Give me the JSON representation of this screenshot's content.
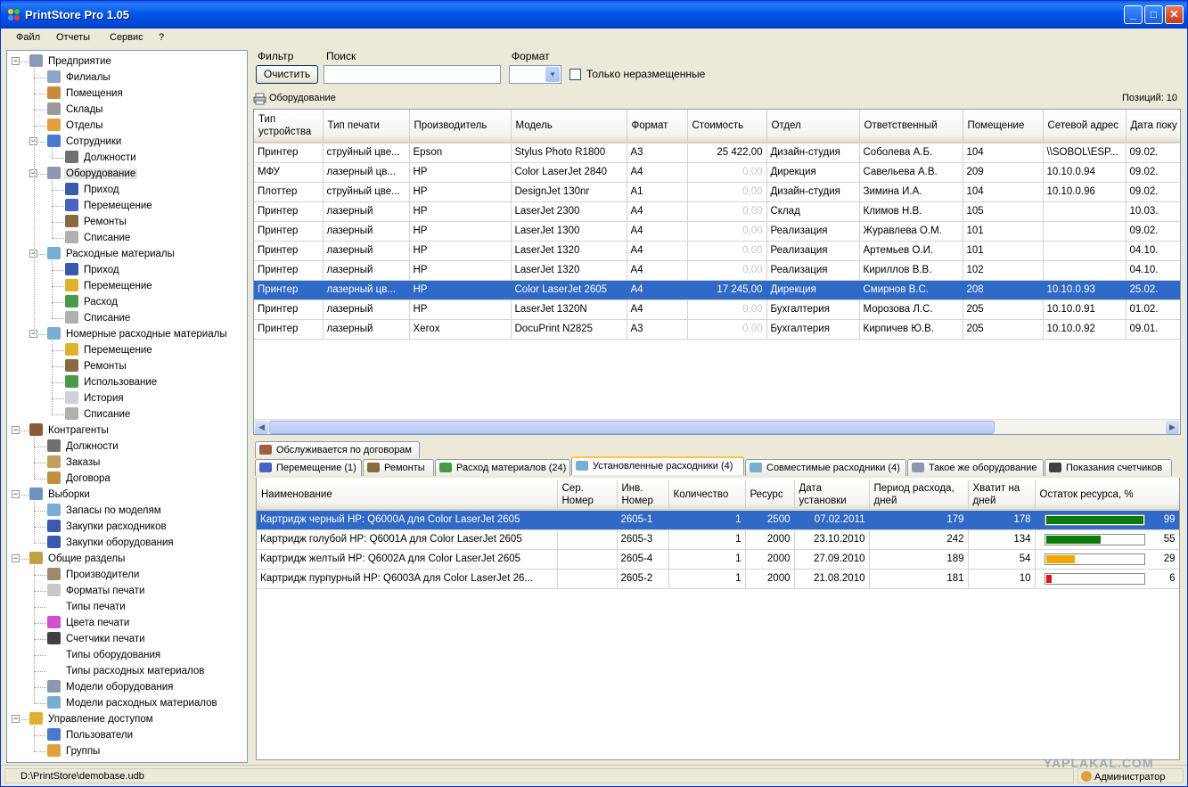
{
  "app": {
    "title": "PrintStore Pro 1.05"
  },
  "menu": [
    "Файл",
    "Отчеты",
    "Сервис",
    "?"
  ],
  "tree": [
    {
      "label": "Предприятие",
      "level": 0,
      "toggle": "−",
      "icon": "building-icon",
      "color": "#8a9ab8"
    },
    {
      "label": "Филиалы",
      "level": 1,
      "icon": "office-icon",
      "color": "#8fa4c8"
    },
    {
      "label": "Помещения",
      "level": 1,
      "icon": "door-icon",
      "color": "#c98a3a"
    },
    {
      "label": "Склады",
      "level": 1,
      "icon": "warehouse-icon",
      "color": "#9a9a9a"
    },
    {
      "label": "Отделы",
      "level": 1,
      "icon": "people-icon",
      "color": "#e0a040"
    },
    {
      "label": "Сотрудники",
      "level": 1,
      "toggle": "−",
      "icon": "employee-icon",
      "color": "#4a7ad0"
    },
    {
      "label": "Должности",
      "level": 2,
      "icon": "position-icon",
      "color": "#707070"
    },
    {
      "label": "Оборудование",
      "level": 1,
      "toggle": "−",
      "icon": "printer-icon",
      "color": "#8c98b0",
      "selected": true
    },
    {
      "label": "Приход",
      "level": 2,
      "icon": "truck-icon",
      "color": "#3a5ab0"
    },
    {
      "label": "Перемещение",
      "level": 2,
      "icon": "cart-icon",
      "color": "#4a62c0"
    },
    {
      "label": "Ремонты",
      "level": 2,
      "icon": "hammer-icon",
      "color": "#8a6a40"
    },
    {
      "label": "Списание",
      "level": 2,
      "icon": "writeoff-icon",
      "color": "#b0b0b0"
    },
    {
      "label": "Расходные материалы",
      "level": 1,
      "toggle": "−",
      "icon": "cartridge-icon",
      "color": "#7aaed0"
    },
    {
      "label": "Приход",
      "level": 2,
      "icon": "truck-icon",
      "color": "#3a5ab0"
    },
    {
      "label": "Перемещение",
      "level": 2,
      "icon": "move-icon",
      "color": "#e0b030"
    },
    {
      "label": "Расход",
      "level": 2,
      "icon": "consumption-icon",
      "color": "#4a9a4a"
    },
    {
      "label": "Списание",
      "level": 2,
      "icon": "writeoff-icon",
      "color": "#b0b0b0"
    },
    {
      "label": "Номерные расходные материалы",
      "level": 1,
      "toggle": "−",
      "icon": "numbered-cartridge-icon",
      "color": "#7aaed0"
    },
    {
      "label": "Перемещение",
      "level": 2,
      "icon": "move-icon",
      "color": "#e0b030"
    },
    {
      "label": "Ремонты",
      "level": 2,
      "icon": "hammer-icon",
      "color": "#8a6a40"
    },
    {
      "label": "Использование",
      "level": 2,
      "icon": "usage-icon",
      "color": "#4a9a4a"
    },
    {
      "label": "История",
      "level": 2,
      "icon": "history-icon",
      "color": "#d0d0d8"
    },
    {
      "label": "Списание",
      "level": 2,
      "icon": "writeoff-icon",
      "color": "#b0b0b0"
    },
    {
      "label": "Контрагенты",
      "level": 0,
      "toggle": "−",
      "icon": "contractors-icon",
      "color": "#8a5a3a"
    },
    {
      "label": "Должности",
      "level": 1,
      "icon": "position-icon",
      "color": "#707070"
    },
    {
      "label": "Заказы",
      "level": 1,
      "icon": "orders-icon",
      "color": "#c0a060"
    },
    {
      "label": "Договора",
      "level": 1,
      "icon": "contract-icon",
      "color": "#c09040"
    },
    {
      "label": "Выборки",
      "level": 0,
      "toggle": "−",
      "icon": "reports-icon",
      "color": "#7090c0"
    },
    {
      "label": "Запасы по моделям",
      "level": 1,
      "icon": "stock-icon",
      "color": "#7aaed0"
    },
    {
      "label": "Закупки расходников",
      "level": 1,
      "icon": "truck-icon",
      "color": "#3a5ab0"
    },
    {
      "label": "Закупки оборудования",
      "level": 1,
      "icon": "truck-icon",
      "color": "#3a5ab0"
    },
    {
      "label": "Общие разделы",
      "level": 0,
      "toggle": "−",
      "icon": "general-icon",
      "color": "#c0a040"
    },
    {
      "label": "Производители",
      "level": 1,
      "icon": "factory-icon",
      "color": "#9a8a70"
    },
    {
      "label": "Форматы печати",
      "level": 1,
      "icon": "format-icon",
      "color": "#c8c8c8"
    },
    {
      "label": "Типы печати",
      "level": 1,
      "icon": "",
      "color": ""
    },
    {
      "label": "Цвета печати",
      "level": 1,
      "icon": "color-wheel-icon",
      "color": "#d050d0"
    },
    {
      "label": "Счетчики печати",
      "level": 1,
      "icon": "counter-icon",
      "color": "#404040"
    },
    {
      "label": "Типы оборудования",
      "level": 1,
      "icon": "",
      "color": ""
    },
    {
      "label": "Типы расходных материалов",
      "level": 1,
      "icon": "",
      "color": ""
    },
    {
      "label": "Модели оборудования",
      "level": 1,
      "icon": "printer-icon",
      "color": "#8c98b0"
    },
    {
      "label": "Модели расходных материалов",
      "level": 1,
      "icon": "cartridge-icon",
      "color": "#7aaed0"
    },
    {
      "label": "Управление доступом",
      "level": 0,
      "toggle": "−",
      "icon": "key-icon",
      "color": "#e0b030"
    },
    {
      "label": "Пользователи",
      "level": 1,
      "icon": "user-icon",
      "color": "#4a7ad0"
    },
    {
      "label": "Группы",
      "level": 1,
      "icon": "group-icon",
      "color": "#e0a040"
    }
  ],
  "filter": {
    "label": "Фильтр",
    "clear_button": "Очистить",
    "search_label": "Поиск",
    "search_value": "",
    "format_label": "Формат",
    "format_value": "",
    "unplaced_label": "Только неразмещенные"
  },
  "equipment": {
    "title": "Оборудование",
    "count": "Позиций: 10",
    "columns": [
      "Тип устройства",
      "Тип печати",
      "Производитель",
      "Модель",
      "Формат",
      "Стоимость",
      "Отдел",
      "Ответственный",
      "Помещение",
      "Сетевой адрес",
      "Дата поку"
    ],
    "rows": [
      [
        "Принтер",
        "струйный цве...",
        "Epson",
        "Stylus Photo R1800",
        "A3",
        "25 422,00",
        "Дизайн-студия",
        "Соболева А.Б.",
        "104",
        "\\\\SOBOL\\ESP...",
        "09.02."
      ],
      [
        "МФУ",
        "лазерный цв...",
        "HP",
        "Color LaserJet 2840",
        "A4",
        "0,00",
        "Дирекция",
        "Савельева А.В.",
        "209",
        "10.10.0.94",
        "09.02."
      ],
      [
        "Плоттер",
        "струйный цве...",
        "HP",
        "DesignJet 130nr",
        "A1",
        "0,00",
        "Дизайн-студия",
        "Зимина И.А.",
        "104",
        "10.10.0.96",
        "09.02."
      ],
      [
        "Принтер",
        "лазерный",
        "HP",
        "LaserJet 2300",
        "A4",
        "0,00",
        "Склад",
        "Климов Н.В.",
        "105",
        "",
        "10.03."
      ],
      [
        "Принтер",
        "лазерный",
        "HP",
        "LaserJet 1300",
        "A4",
        "0,00",
        "Реализация",
        "Журавлева О.М.",
        "101",
        "",
        "09.02."
      ],
      [
        "Принтер",
        "лазерный",
        "HP",
        "LaserJet 1320",
        "A4",
        "0,00",
        "Реализация",
        "Артемьев О.И.",
        "101",
        "",
        "04.10."
      ],
      [
        "Принтер",
        "лазерный",
        "HP",
        "LaserJet 1320",
        "A4",
        "0,00",
        "Реализация",
        "Кириллов В.В.",
        "102",
        "",
        "04.10."
      ],
      [
        "Принтер",
        "лазерный цв...",
        "HP",
        "Color LaserJet 2605",
        "A4",
        "17 245,00",
        "Дирекция",
        "Смирнов В.С.",
        "208",
        "10.10.0.93",
        "25.02."
      ],
      [
        "Принтер",
        "лазерный",
        "HP",
        "LaserJet 1320N",
        "A4",
        "0,00",
        "Бухгалтерия",
        "Морозова Л.С.",
        "205",
        "10.10.0.91",
        "01.02."
      ],
      [
        "Принтер",
        "лазерный",
        "Xerox",
        "DocuPrint N2825",
        "A3",
        "0,00",
        "Бухгалтерия",
        "Кирпичев Ю.В.",
        "205",
        "10.10.0.92",
        "09.01."
      ]
    ],
    "selected_row": 7
  },
  "tabs_top": [
    {
      "label": "Обслуживается по договорам",
      "icon": "contract-stamp-icon",
      "color": "#a06040"
    }
  ],
  "tabs": [
    {
      "label": "Перемещение (1)",
      "icon": "cart-icon",
      "color": "#4a62c0"
    },
    {
      "label": "Ремонты",
      "icon": "hammer-icon",
      "color": "#8a6a40"
    },
    {
      "label": "Расход материалов (24)",
      "icon": "consumption-icon",
      "color": "#4a9a4a"
    },
    {
      "label": "Установленные расходники (4)",
      "icon": "cartridge-icon",
      "color": "#7aaed0",
      "active": true
    },
    {
      "label": "Совместимые расходники (4)",
      "icon": "cartridge-icon",
      "color": "#7aaed0"
    },
    {
      "label": "Такое же оборудование",
      "icon": "printer-icon",
      "color": "#8c98b0"
    },
    {
      "label": "Показания счетчиков",
      "icon": "counter-icon",
      "color": "#404040"
    }
  ],
  "consumables": {
    "columns": [
      "Наименование",
      "Сер. Номер",
      "Инв. Номер",
      "Количество",
      "Ресурс",
      "Дата установки",
      "Период расхода, дней",
      "Хватит на дней",
      "Остаток ресурса, %"
    ],
    "rows": [
      {
        "name": "Картридж черный HP: Q6000A для Color LaserJet 2605",
        "serial": "",
        "inv": "2605-1",
        "qty": "1",
        "resource": "2500",
        "date": "07.02.2011",
        "period": "179",
        "days_left": "178",
        "percent": "99",
        "bar_color": "#0a7a0a"
      },
      {
        "name": "Картридж голубой HP: Q6001A для Color LaserJet 2605",
        "serial": "",
        "inv": "2605-3",
        "qty": "1",
        "resource": "2000",
        "date": "23.10.2010",
        "period": "242",
        "days_left": "134",
        "percent": "55",
        "bar_color": "#0a7a0a"
      },
      {
        "name": "Картридж желтый HP: Q6002A для Color LaserJet 2605",
        "serial": "",
        "inv": "2605-4",
        "qty": "1",
        "resource": "2000",
        "date": "27.09.2010",
        "period": "189",
        "days_left": "54",
        "percent": "29",
        "bar_color": "#f0a800"
      },
      {
        "name": "Картридж пурпурный HP: Q6003A для Color LaserJet 26...",
        "serial": "",
        "inv": "2605-2",
        "qty": "1",
        "resource": "2000",
        "date": "21.08.2010",
        "period": "181",
        "days_left": "10",
        "percent": "6",
        "bar_color": "#e01010"
      }
    ],
    "selected_row": 0
  },
  "status": {
    "path": "D:\\PrintStore\\demobase.udb",
    "user": "Администратор",
    "watermark": "YAPLAKAL.COM"
  }
}
